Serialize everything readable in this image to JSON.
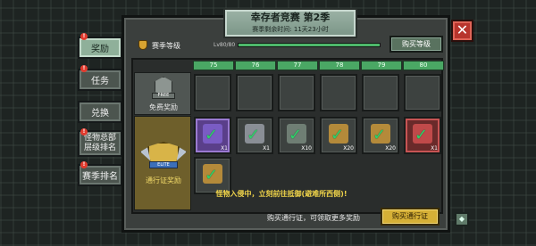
{
  "title": {
    "name": "幸存者竞赛 第2季",
    "remaining": "赛季剩余时间: 11天23小时"
  },
  "tabs": [
    {
      "label": "奖励",
      "badge": "!"
    },
    {
      "label": "任务",
      "badge": "!"
    },
    {
      "label": "兑换"
    },
    {
      "label": "怪物总部\n层级排名",
      "badge": "!"
    },
    {
      "label": "赛季排名",
      "badge": "!"
    }
  ],
  "header": {
    "season_level_label": "赛季等级",
    "level_text": "Lv80/80",
    "level_progress": 1.0,
    "buy_level_label": "购买等级"
  },
  "levels": [
    "75",
    "76",
    "77",
    "78",
    "79",
    "80"
  ],
  "free_row": {
    "label": "免费奖励",
    "tag": "FREE"
  },
  "pass_row": {
    "label": "通行证奖励",
    "tag": "ELITE"
  },
  "free_rewards": [
    {
      "qty": ""
    },
    {
      "qty": ""
    },
    {
      "qty": ""
    },
    {
      "qty": ""
    },
    {
      "qty": ""
    },
    {
      "qty": ""
    }
  ],
  "pass_rewards": [
    {
      "qty": "X1",
      "rarity": "purple",
      "icon": "crate-icon",
      "claimed": true
    },
    {
      "qty": "X1",
      "rarity": "normal",
      "icon": "armor-icon",
      "claimed": true
    },
    {
      "qty": "X10",
      "rarity": "normal",
      "icon": "wrench-icon",
      "claimed": true
    },
    {
      "qty": "X20",
      "rarity": "normal",
      "icon": "ammo-icon",
      "claimed": true
    },
    {
      "qty": "X20",
      "rarity": "normal",
      "icon": "ammo-icon",
      "claimed": true
    },
    {
      "qty": "X1",
      "rarity": "red",
      "icon": "rocket-icon",
      "claimed": true
    },
    {
      "qty": "",
      "rarity": "normal",
      "icon": "ammo-icon",
      "claimed": true
    }
  ],
  "notice": "怪物入侵中，立刻前往抵御(避难所西侧)!",
  "footer": {
    "hint": "购买通行证，可领取更多奖励",
    "buy_pass_label": "购买通行证"
  },
  "colors": {
    "accent_green": "#4aa764",
    "gold": "#d6b036",
    "close_red": "#b8352d",
    "notice_yellow": "#f0d44a"
  }
}
